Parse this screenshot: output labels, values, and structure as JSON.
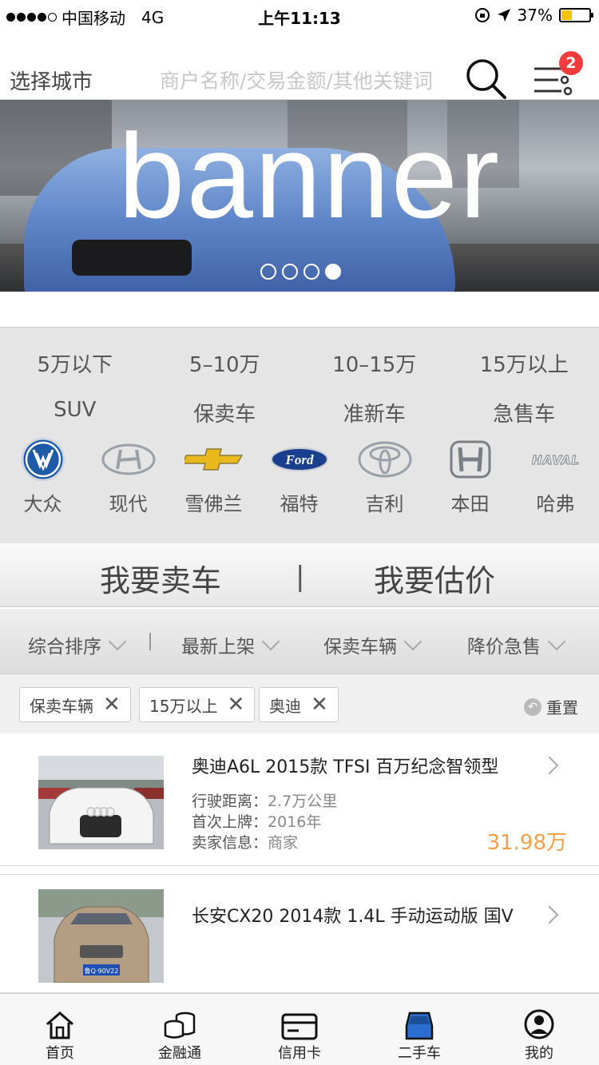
{
  "status": {
    "carrier": "中国移动",
    "network": "4G",
    "time": "上午11:13",
    "battery": "37%",
    "battery_level": 0.37
  },
  "header": {
    "city": "选择城市",
    "search_placeholder": "商户名称/交易金额/其他关键词",
    "menu_badge": "2"
  },
  "banner": {
    "text": "banner",
    "pages": 4,
    "current_page": 4
  },
  "price_filters": [
    "5万以下",
    "5–10万",
    "10–15万",
    "15万以上"
  ],
  "type_filters": [
    "SUV",
    "保卖车",
    "准新车",
    "急售车"
  ],
  "brands": [
    {
      "label": "大众",
      "icon": "volkswagen-logo-icon"
    },
    {
      "label": "现代",
      "icon": "hyundai-logo-icon"
    },
    {
      "label": "雪佛兰",
      "icon": "chevrolet-logo-icon"
    },
    {
      "label": "福特",
      "icon": "ford-logo-icon"
    },
    {
      "label": "吉利",
      "icon": "toyota-logo-icon"
    },
    {
      "label": "本田",
      "icon": "honda-logo-icon"
    },
    {
      "label": "哈弗",
      "icon": "haval-logo-icon"
    }
  ],
  "ford_text": "Ford",
  "haval_text": "HAVAL",
  "actions": {
    "sell": "我要卖车",
    "separator": "|",
    "estimate": "我要估价"
  },
  "sort": [
    "综合排序",
    "最新上架",
    "保卖车辆",
    "降价急售"
  ],
  "chips": [
    "保卖车辆",
    "15万以上",
    "奥迪"
  ],
  "chip_close": "✕",
  "reset": "重置",
  "listings": [
    {
      "title": "奥迪A6L 2015款 TFSI 百万纪念智领型",
      "mileage_label": "行驶距离：",
      "mileage": "2.7万公里",
      "reg_label": "首次上牌：",
      "reg": "2016年",
      "seller_label": "卖家信息：",
      "seller": "商家",
      "price": "31.98万"
    },
    {
      "title": "长安CX20 2014款 1.4L 手动运动版 国V",
      "plate": "鲁Q·90V22"
    }
  ],
  "tabs": [
    {
      "label": "首页",
      "icon": "home-icon"
    },
    {
      "label": "金融通",
      "icon": "coins-icon"
    },
    {
      "label": "信用卡",
      "icon": "credit-card-icon"
    },
    {
      "label": "二手车",
      "icon": "car-icon"
    },
    {
      "label": "我的",
      "icon": "profile-icon"
    }
  ]
}
